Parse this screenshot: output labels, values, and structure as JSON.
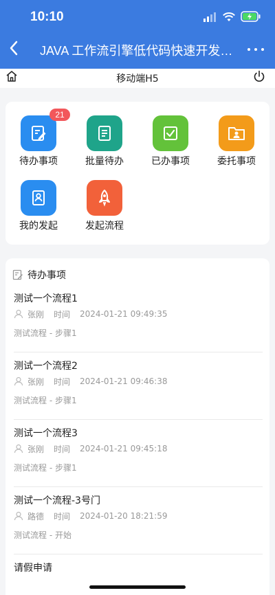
{
  "status_bar": {
    "time": "10:10"
  },
  "nav": {
    "title": "JAVA 工作流引擎低代码快速开发…"
  },
  "subheader": {
    "title": "移动端H5"
  },
  "grid": [
    {
      "label": "待办事项",
      "badge": "21",
      "color": "#2a8df0",
      "icon": "edit-icon"
    },
    {
      "label": "批量待办",
      "color": "#1fa48a",
      "icon": "document-icon"
    },
    {
      "label": "已办事项",
      "color": "#63c23a",
      "icon": "check-icon"
    },
    {
      "label": "委托事项",
      "color": "#f39b1a",
      "icon": "folder-user-icon"
    },
    {
      "label": "我的发起",
      "color": "#2a8df0",
      "icon": "user-card-icon"
    },
    {
      "label": "发起流程",
      "color": "#f2613a",
      "icon": "rocket-icon"
    }
  ],
  "pending": {
    "header": "待办事项",
    "time_label": "时间",
    "items": [
      {
        "title": "测试一个流程1",
        "user": "张刚",
        "datetime": "2024-01-21 09:49:35",
        "step": "测试流程 - 步骤1"
      },
      {
        "title": "测试一个流程2",
        "user": "张刚",
        "datetime": "2024-01-21 09:46:38",
        "step": "测试流程 - 步骤1"
      },
      {
        "title": "测试一个流程3",
        "user": "张刚",
        "datetime": "2024-01-21 09:45:18",
        "step": "测试流程 - 步骤1"
      },
      {
        "title": "测试一个流程-3号门",
        "user": "路德",
        "datetime": "2024-01-20 18:21:59",
        "step": "测试流程 - 开始"
      }
    ],
    "last_title": "请假申请"
  }
}
